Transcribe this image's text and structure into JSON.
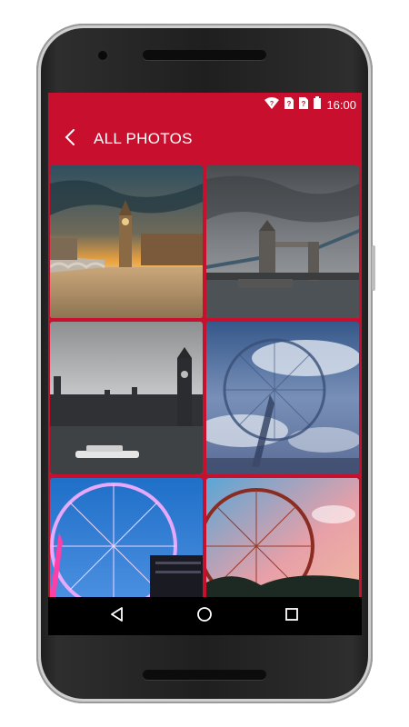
{
  "status": {
    "time": "16:00",
    "icons": [
      "wifi-icon",
      "sim-1-icon",
      "sim-2-icon",
      "battery-icon"
    ]
  },
  "appbar": {
    "title": "ALL PHOTOS",
    "back_icon": "chevron-left-icon",
    "background": "#c8102e"
  },
  "photos": [
    {
      "subject": "big-ben-sunset"
    },
    {
      "subject": "tower-bridge"
    },
    {
      "subject": "parliament-thames"
    },
    {
      "subject": "london-eye-clouds"
    },
    {
      "subject": "london-eye-purple"
    },
    {
      "subject": "ferris-wheel-sunset"
    }
  ],
  "navbar": {
    "buttons": [
      "back-triangle-icon",
      "home-circle-icon",
      "recents-square-icon"
    ]
  }
}
